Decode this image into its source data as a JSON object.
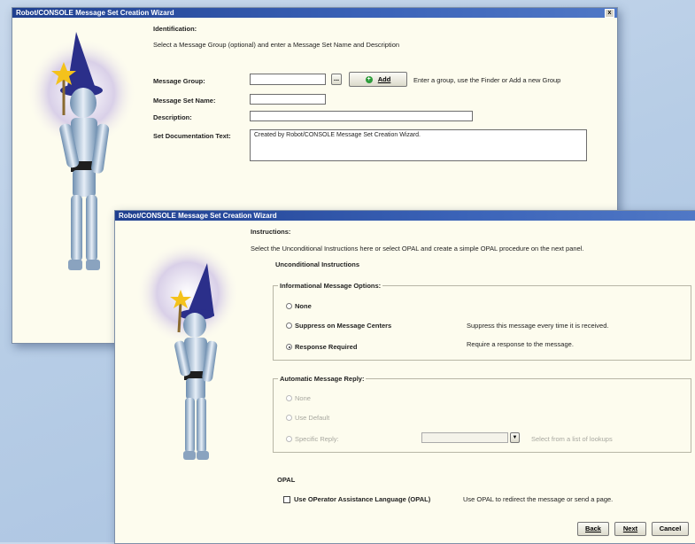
{
  "window1": {
    "title": "Robot/CONSOLE Message Set Creation Wizard",
    "close": "x",
    "heading": "Identification:",
    "subtitle": "Select a Message Group (optional) and enter a Message Set Name and Description",
    "group_label": "Message Group:",
    "finder_label": "...",
    "add_label": "Add",
    "group_hint": "Enter a group, use the Finder or Add a new Group",
    "name_label": "Message Set Name:",
    "desc_label": "Description:",
    "doc_label": "Set Documentation Text:",
    "doc_value": "Created by Robot/CONSOLE Message Set Creation Wizard."
  },
  "window2": {
    "title": "Robot/CONSOLE Message Set Creation Wizard",
    "heading": "Instructions:",
    "subtitle": "Select the Unconditional Instructions here or select OPAL and create a simple OPAL procedure on the next panel.",
    "unconditional_label": "Unconditional Instructions",
    "info_options_label": "Informational Message Options:",
    "opt_none": "None",
    "opt_suppress": "Suppress on Message Centers",
    "opt_suppress_desc": "Suppress this message every time it is received.",
    "opt_response": "Response Required",
    "opt_response_desc": "Require a response to the message.",
    "auto_reply_label": "Automatic Message Reply:",
    "auto_none": "None",
    "auto_default": "Use Default",
    "auto_specific": "Specific Reply:",
    "auto_select_hint": "Select from a list of lookups",
    "opal_label": "OPAL",
    "opal_check": "Use OPerator Assistance Language (OPAL)",
    "opal_desc": "Use OPAL to redirect the message or send a page.",
    "back": "Back",
    "next": "Next",
    "cancel": "Cancel"
  },
  "colors": {
    "titlebar": "#1f3f8f",
    "panel": "#fdfcee",
    "background": "#b7cde6"
  },
  "icons": [
    "wizard-robot-illustration",
    "add-icon",
    "finder-icon",
    "dropdown-arrow-icon",
    "close-icon"
  ]
}
